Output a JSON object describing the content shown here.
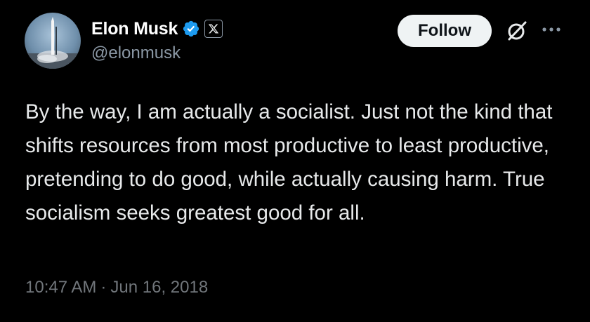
{
  "author": {
    "display_name": "Elon Musk",
    "handle": "@elonmusk",
    "avatar_icon": "rocket-launch-avatar",
    "verified_icon": "verified-badge-icon",
    "affiliate_icon": "x-logo-icon"
  },
  "actions": {
    "follow_label": "Follow",
    "grok_icon": "grok-icon",
    "more_icon": "more-options-icon"
  },
  "tweet": {
    "text": "By the way, I am actually a socialist. Just not the kind that shifts resources from most productive to least productive, pretending to do good, while actually causing harm. True socialism seeks greatest good for all.",
    "time": "10:47 AM",
    "separator": "·",
    "date": "Jun 16, 2018"
  },
  "colors": {
    "background": "#000000",
    "primary_text": "#e7e9ea",
    "secondary_text": "#8b98a5",
    "verified_blue": "#1d9bf0",
    "button_bg": "#eff3f4"
  }
}
